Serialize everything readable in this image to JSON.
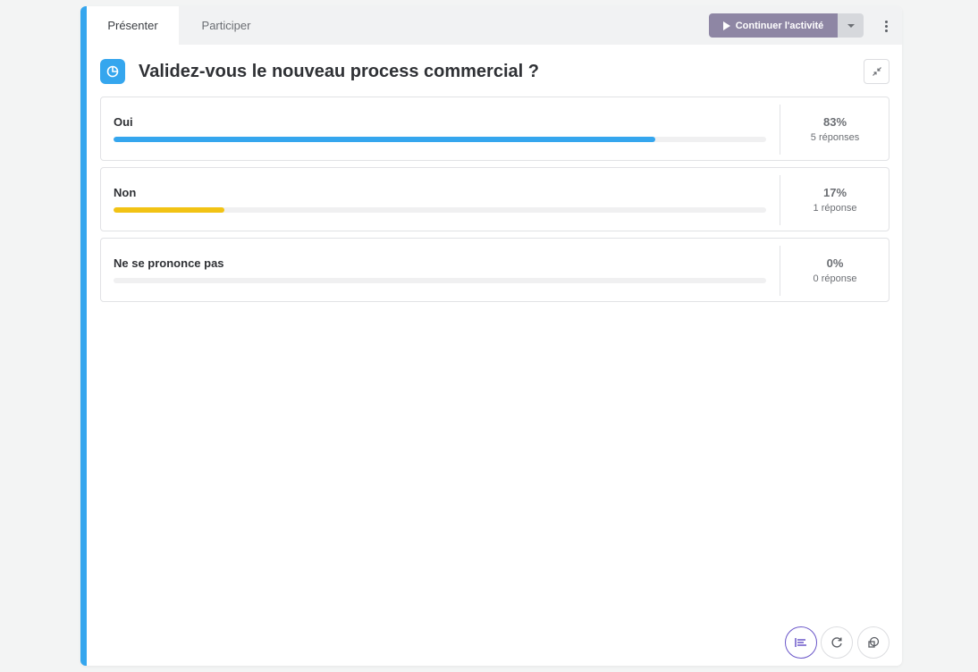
{
  "tabs": [
    {
      "label": "Présenter",
      "active": true
    },
    {
      "label": "Participer",
      "active": false
    }
  ],
  "toolbar": {
    "continue_label": "Continuer l'activité",
    "continue_color": "#8e86a4"
  },
  "question": {
    "title": "Validez-vous le nouveau process commercial ?",
    "icon": "pie-chart-icon",
    "accent_color": "#35a6ee"
  },
  "answers": [
    {
      "label": "Oui",
      "percent_label": "83%",
      "count_label": "5 réponses",
      "fraction": 0.83,
      "color": "#35a6ee"
    },
    {
      "label": "Non",
      "percent_label": "17%",
      "count_label": "1 réponse",
      "fraction": 0.17,
      "color": "#f2c314"
    },
    {
      "label": "Ne se prononce pas",
      "percent_label": "0%",
      "count_label": "0 réponse",
      "fraction": 0,
      "color": "#b0b0b0"
    }
  ],
  "bottom_controls": [
    {
      "icon": "bar-list-icon",
      "active": true
    },
    {
      "icon": "refresh-icon",
      "active": false
    },
    {
      "icon": "shapes-icon",
      "active": false
    }
  ]
}
